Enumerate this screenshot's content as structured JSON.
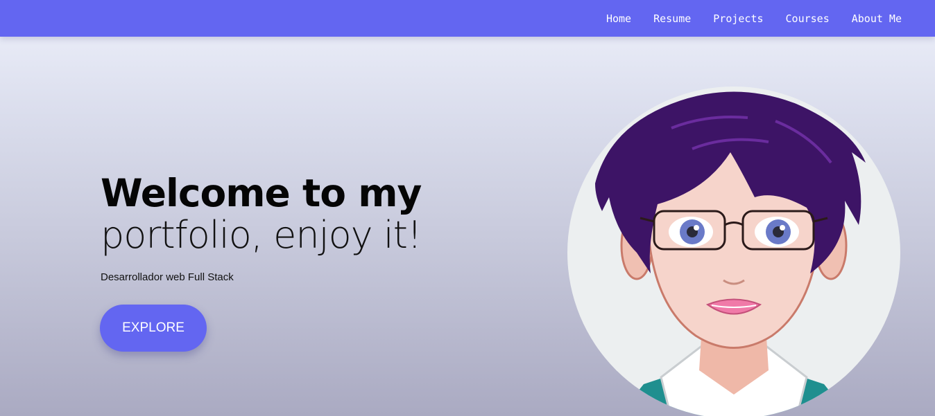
{
  "nav": {
    "items": [
      {
        "label": "Home"
      },
      {
        "label": "Resume"
      },
      {
        "label": "Projects"
      },
      {
        "label": "Courses"
      },
      {
        "label": "About Me"
      }
    ]
  },
  "hero": {
    "headline_line1": "Welcome to my",
    "headline_line2": "portfolio, enjoy it!",
    "subtitle": "Desarrollador web Full Stack",
    "button_label": "EXPLORE"
  },
  "avatar": {
    "icon": "avatar-illustration",
    "description_hint": "cartoon portrait, purple hair, glasses"
  },
  "colors": {
    "accent": "#6366f1",
    "hair": "#3d1466",
    "background_top": "#eef1fb",
    "background_bottom": "#aaaac2"
  }
}
